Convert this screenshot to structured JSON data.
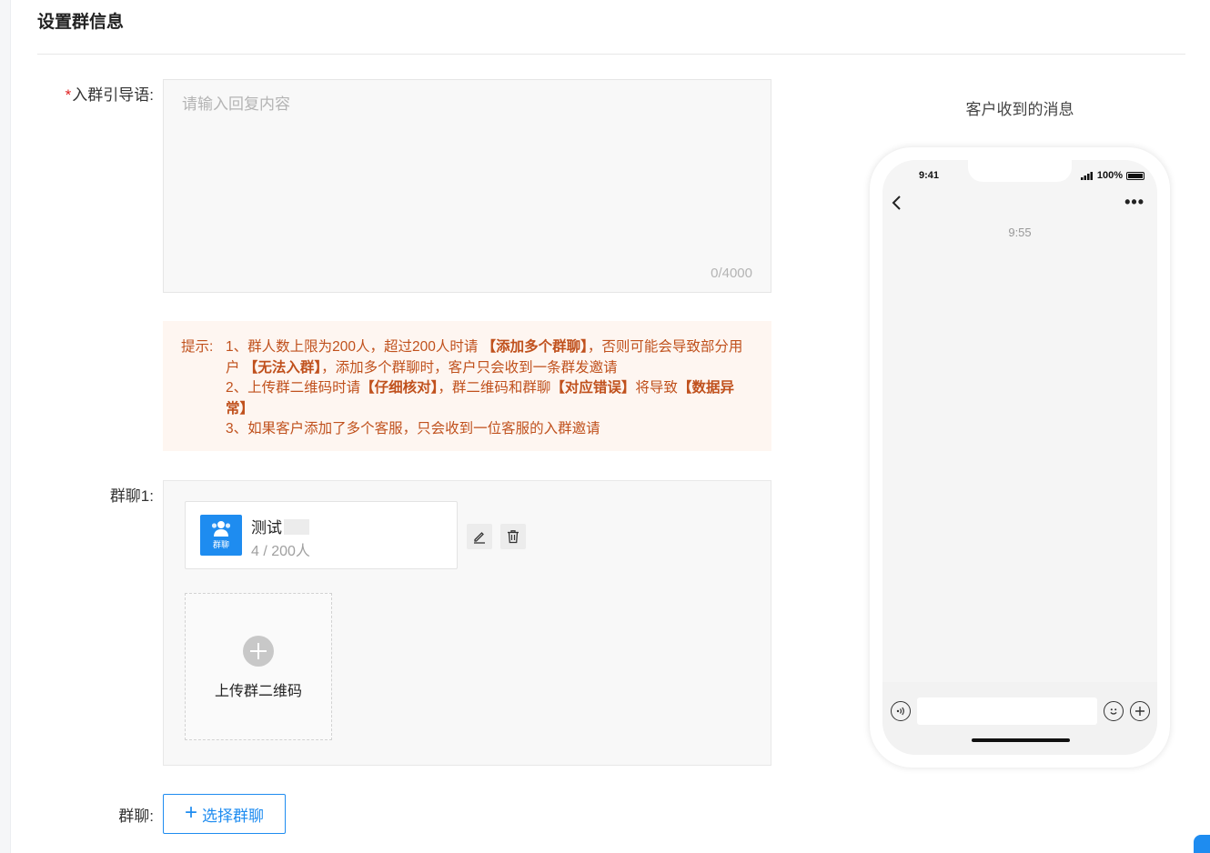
{
  "page": {
    "title": "设置群信息"
  },
  "form": {
    "guide_label": "入群引导语:",
    "guide_required_mark": "*",
    "guide_placeholder": "请输入回复内容",
    "guide_counter": "0/4000",
    "tip": {
      "prefix": "提示:",
      "line1_a": "1、群人数上限为200人，超过200人时请 ",
      "line1_b": "【添加多个群聊】",
      "line1_c": "，否则可能会导致部分用户 ",
      "line1_d": "【无法入群】",
      "line1_e": "，添加多个群聊时，客户只会收到一条群发邀请",
      "line2_a": "2、上传群二维码时请",
      "line2_b": "【仔细核对】",
      "line2_c": "，群二维码和群聊",
      "line2_d": "【对应错误】",
      "line2_e": "将导致",
      "line2_f": "【数据异常】",
      "line3": "3、如果客户添加了多个客服，只会收到一位客服的入群邀请"
    },
    "group1_label": "群聊1:",
    "group_card": {
      "avatar_tag": "群聊",
      "name": "测试",
      "count": "4 / 200人"
    },
    "upload_label": "上传群二维码",
    "group_label": "群聊:",
    "select_button": "选择群聊",
    "select_button_icon": "+"
  },
  "preview": {
    "title": "客户收到的消息",
    "status_time": "9:41",
    "battery_text": "100%",
    "more_icon": "•••",
    "chat_time": "9:55"
  },
  "colors": {
    "accent": "#1e8cf0",
    "tip_text": "#c0511d",
    "tip_bg": "#fef6f1",
    "required": "#e02020"
  }
}
